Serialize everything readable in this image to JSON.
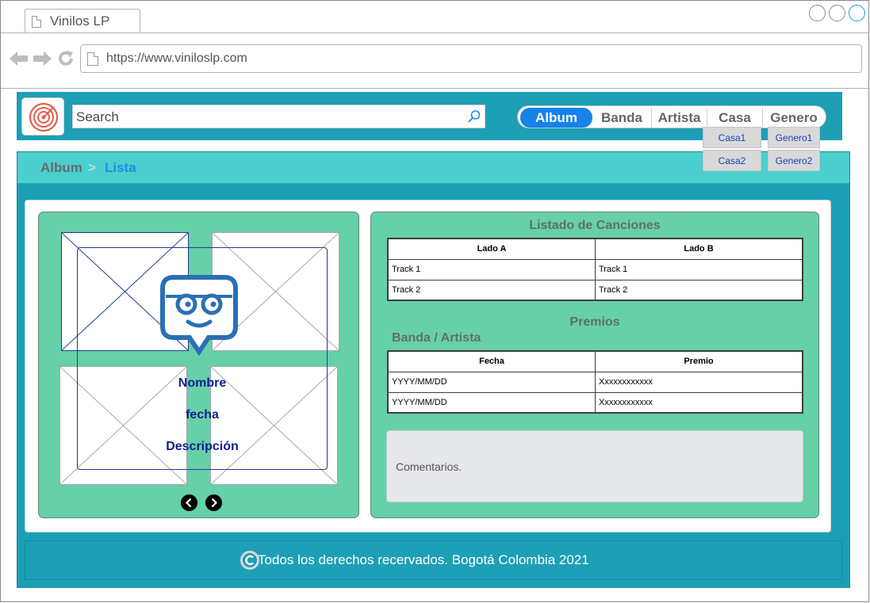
{
  "browser": {
    "tab_title": "Vinilos LP",
    "url": "https://www.vinilosl p.com"
  },
  "header": {
    "search_placeholder": "Search",
    "nav": [
      "Album",
      "Banda",
      "Artista",
      "Casa",
      "Genero"
    ],
    "active_nav": "Album",
    "casa_menu": [
      "Casa1",
      "Casa2"
    ],
    "genero_menu": [
      "Genero1",
      "Genero2"
    ]
  },
  "breadcrumb": {
    "parent": "Album",
    "separator": ">",
    "current": "Lista"
  },
  "album_card": {
    "name_label": "Nombre",
    "date_label": "fecha",
    "description_label": "Descripción"
  },
  "songs": {
    "title": "Listado de Canciones",
    "columns": [
      "Lado A",
      "Lado B"
    ],
    "rows": [
      [
        "Track 1",
        "Track 1"
      ],
      [
        "Track 2",
        "Track 2"
      ]
    ]
  },
  "awards": {
    "title": "Premios",
    "subtitle": "Banda / Artista",
    "columns": [
      "Fecha",
      "Premio"
    ],
    "rows": [
      [
        "YYYY/MM/DD",
        "Xxxxxxxxxxxx"
      ],
      [
        "YYYY/MM/DD",
        "Xxxxxxxxxxxx"
      ]
    ]
  },
  "comments_placeholder": "Comentarios.",
  "footer_text": "Todos los derechos recervados. Bogotá Colombia 2021",
  "colors": {
    "header_bg": "#1d9fb6",
    "crumb_bg": "#4bcfcf",
    "card_bg": "#66d0a8",
    "active_tab": "#1583e8"
  }
}
